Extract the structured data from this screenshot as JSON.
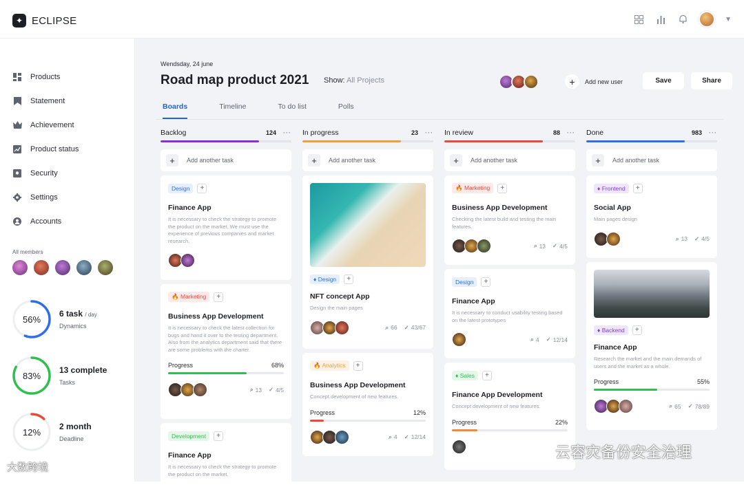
{
  "app": {
    "name": "ECLIPSE"
  },
  "sidebar": {
    "items": [
      {
        "label": "Products",
        "icon": "grid-icon"
      },
      {
        "label": "Statement",
        "icon": "bookmark-icon"
      },
      {
        "label": "Achievement",
        "icon": "crown-icon"
      },
      {
        "label": "Product status",
        "icon": "chart-icon"
      },
      {
        "label": "Security",
        "icon": "shield-icon"
      },
      {
        "label": "Settings",
        "icon": "gear-icon"
      },
      {
        "label": "Accounts",
        "icon": "user-icon"
      }
    ],
    "members_label": "All members",
    "stats": [
      {
        "percent": "56%",
        "fraction": 0.56,
        "main": "6 task",
        "unit": "/ day",
        "sub": "Dynamics",
        "color": "#2f6fe6"
      },
      {
        "percent": "83%",
        "fraction": 0.83,
        "main": "13 complete",
        "unit": "",
        "sub": "Tasks",
        "color": "#2fbf4f"
      },
      {
        "percent": "12%",
        "fraction": 0.12,
        "main": "2 month",
        "unit": "",
        "sub": "Deadline",
        "color": "#e84b3c"
      }
    ]
  },
  "header": {
    "date": "Wendsday, 24 june",
    "title": "Road map product 2021",
    "show_label": "Show:",
    "show_value": "All Projects",
    "add_user": "Add new user",
    "save": "Save",
    "share": "Share"
  },
  "tabs": [
    "Boards",
    "Timeline",
    "To do list",
    "Polls"
  ],
  "columns": [
    {
      "name": "Backlog",
      "count": "124",
      "color": "#8b2fd1",
      "fill": 0.75,
      "add": "Add another task",
      "cards": [
        {
          "tag": "Design",
          "tag_bg": "#e6effd",
          "tag_fg": "#2f6fe6",
          "title": "Finance App",
          "desc": "It is necessary to check the strategy to promote the product on the market. We must use the experience of previous companies and market research."
        },
        {
          "tag": "Marketing",
          "tag_bg": "#fde9e7",
          "tag_fg": "#e84b3c",
          "title": "Business App Development",
          "desc": "It is necessary to check the latest collection for bugs and hand it over to the testing department. Also from the analytics department said that there are some problems with the charter.",
          "progress_label": "Progress",
          "progress": "68%",
          "progress_fill": 0.68,
          "progress_color": "#2fbf4f",
          "attach": "13",
          "done": "4/5"
        },
        {
          "tag": "Development",
          "tag_bg": "#e5f7e9",
          "tag_fg": "#2fbf4f",
          "title": "Finance App",
          "desc": "It is necessary to check the strategy to promote the product on the market."
        }
      ]
    },
    {
      "name": "In progress",
      "count": "23",
      "color": "#f0a13a",
      "fill": 0.75,
      "add": "Add another task",
      "cards": [
        {
          "tag": "Design",
          "tag_bg": "#e6effd",
          "tag_fg": "#2f6fe6",
          "title": "NFT concept App",
          "desc": "Design the main pages",
          "attach": "66",
          "done": "43/67"
        },
        {
          "tag": "Analytics",
          "tag_bg": "#fdf0e4",
          "tag_fg": "#f0a13a",
          "title": "Business App Development",
          "desc": "Concept development of new features.",
          "progress_label": "Progress",
          "progress": "12%",
          "progress_fill": 0.12,
          "progress_color": "#e84b3c",
          "attach": "4",
          "done": "12/14"
        }
      ]
    },
    {
      "name": "In review",
      "count": "88",
      "color": "#e84b3c",
      "fill": 0.75,
      "add": "Add another task",
      "cards": [
        {
          "tag": "Marketing",
          "tag_bg": "#fde9e7",
          "tag_fg": "#e84b3c",
          "title": "Business App Development",
          "desc": "Checking the latest build and testing the main features.",
          "attach": "13",
          "done": "4/5"
        },
        {
          "tag": "Design",
          "tag_bg": "#e6effd",
          "tag_fg": "#2f6fe6",
          "title": "Finance App",
          "desc": "It is necessary to conduct usability testing based on the latest prototypes",
          "attach": "4",
          "done": "12/14"
        },
        {
          "tag": "Sales",
          "tag_bg": "#e5f7e9",
          "tag_fg": "#2fbf4f",
          "title": "Finance App Development",
          "desc": "Concept development of new features.",
          "progress_label": "Progress",
          "progress": "22%",
          "progress_fill": 0.22,
          "progress_color": "#f08a3a"
        }
      ]
    },
    {
      "name": "Done",
      "count": "983",
      "color": "#2f6fe6",
      "fill": 0.75,
      "add": "Add another task",
      "cards": [
        {
          "tag": "Frontend",
          "tag_bg": "#efe6fd",
          "tag_fg": "#7a3fd6",
          "title": "Social App",
          "desc": "Main pages design",
          "attach": "13",
          "done": "4/5"
        },
        {
          "tag": "Backend",
          "tag_bg": "#efe6fd",
          "tag_fg": "#7a3fd6",
          "title": "Finance App",
          "desc": "Research the market and the main demands of users and the market as a whole.",
          "progress_label": "Progress",
          "progress": "55%",
          "progress_fill": 0.55,
          "progress_color": "#2fbf4f",
          "attach": "65",
          "done": "78/89"
        }
      ]
    }
  ],
  "watermarks": {
    "left": "大数跨境",
    "right": "云容灾备份安全治理"
  }
}
